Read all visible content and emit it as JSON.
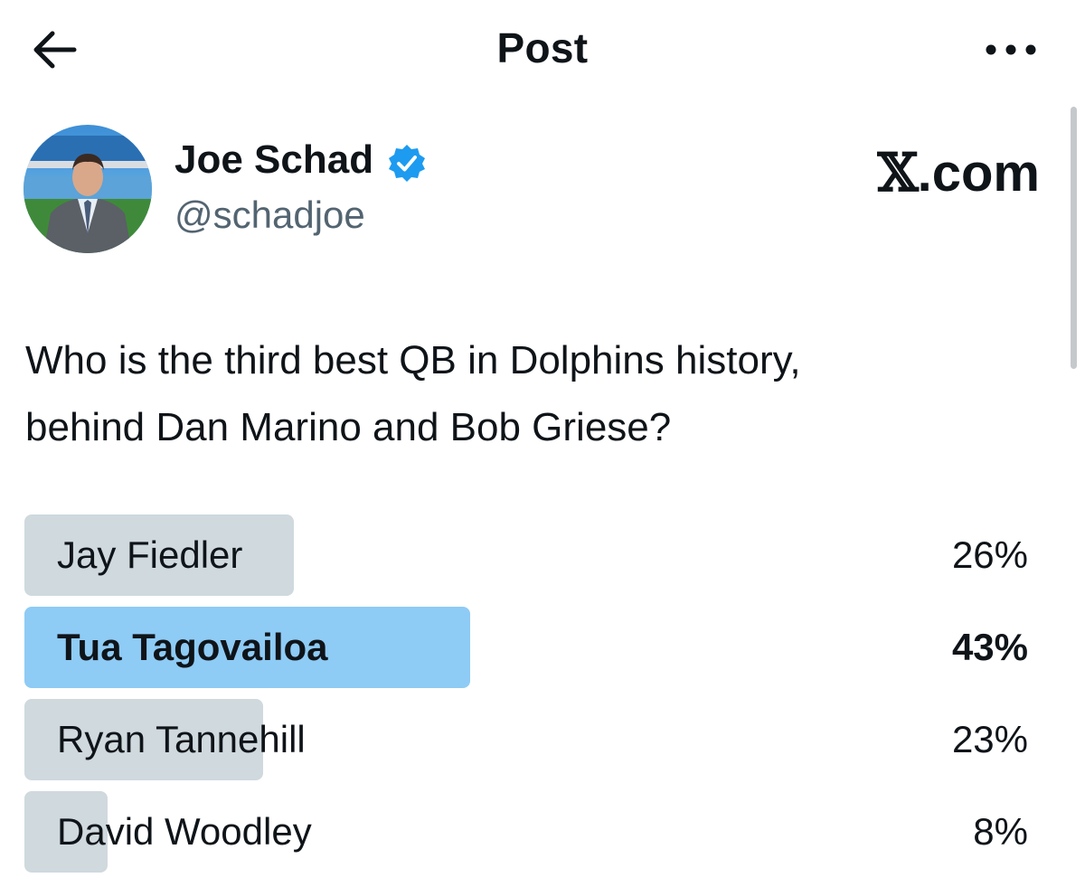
{
  "header": {
    "title": "Post",
    "back_icon": "arrow-left-icon",
    "more_icon": "more-horizontal-icon"
  },
  "author": {
    "name": "Joe Schad",
    "handle": "@schadjoe",
    "verified": true,
    "verified_color": "#1d9bf0"
  },
  "site_logo": {
    "mark": "𝕏",
    "suffix": ".com"
  },
  "post": {
    "text_line1": "Who is the third best QB in Dolphins history,",
    "text_line2": "behind Dan Marino and Bob Griese?"
  },
  "poll": {
    "options": [
      {
        "label": "Jay Fiedler",
        "percent_label": "26%",
        "percent": 26,
        "winner": false
      },
      {
        "label": "Tua Tagovailoa",
        "percent_label": "43%",
        "percent": 43,
        "winner": true
      },
      {
        "label": "Ryan Tannehill",
        "percent_label": "23%",
        "percent": 23,
        "winner": false
      },
      {
        "label": "David Woodley",
        "percent_label": "8%",
        "percent": 8,
        "winner": false
      }
    ],
    "colors": {
      "winner_bar": "#8ecbf5",
      "other_bar": "#cfd9de"
    }
  }
}
